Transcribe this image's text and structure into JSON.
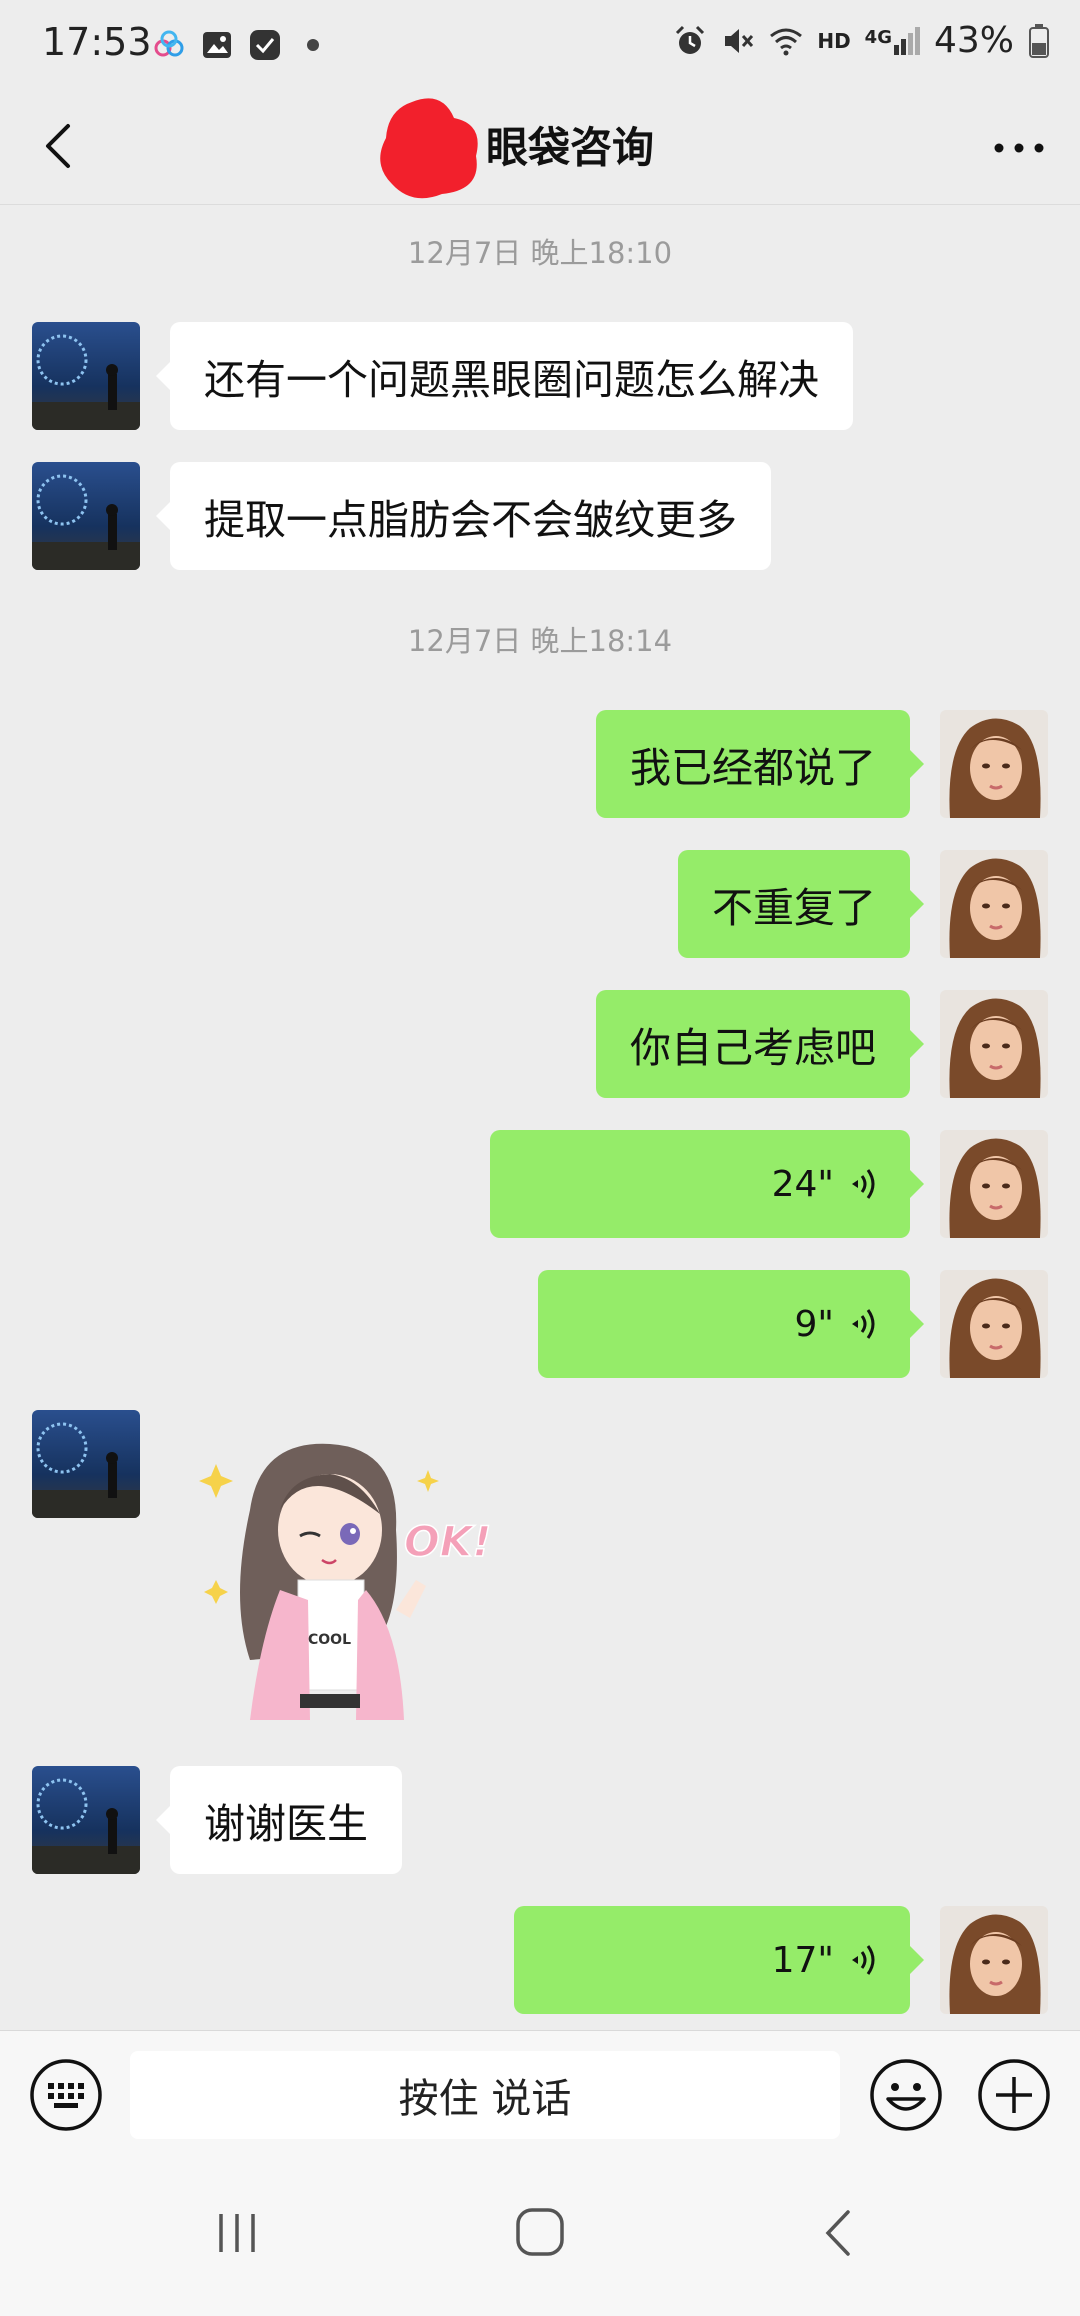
{
  "status_bar": {
    "time": "17:53",
    "network": "HD",
    "signal": "4G",
    "battery": "43%",
    "left_icons": [
      "cloud-icon",
      "gallery-icon",
      "app-check-icon",
      "dot-icon"
    ],
    "right_icons": [
      "alarm-icon",
      "mute-icon",
      "wifi-icon",
      "hd-icon",
      "signal-4g-icon",
      "battery-icon"
    ]
  },
  "header": {
    "title": "眼袋咨询"
  },
  "chat": {
    "timestamps": [
      "12月7日 晚上18:10",
      "12月7日 晚上18:14"
    ],
    "messages": [
      {
        "side": "left",
        "type": "text",
        "text": "还有一个问题黑眼圈问题怎么解决"
      },
      {
        "side": "left",
        "type": "text",
        "text": "提取一点脂肪会不会皱纹更多"
      },
      {
        "side": "right",
        "type": "text",
        "text": "我已经都说了"
      },
      {
        "side": "right",
        "type": "text",
        "text": "不重复了"
      },
      {
        "side": "right",
        "type": "text",
        "text": "你自己考虑吧"
      },
      {
        "side": "right",
        "type": "voice",
        "text": "24\""
      },
      {
        "side": "right",
        "type": "voice",
        "text": "9\""
      },
      {
        "side": "left",
        "type": "sticker",
        "text": "OK!"
      },
      {
        "side": "left",
        "type": "text",
        "text": "谢谢医生"
      },
      {
        "side": "right",
        "type": "voice",
        "text": "17\""
      }
    ],
    "sticker_shirt_text": "COOL"
  },
  "input_bar": {
    "hold_to_talk": "按住 说话"
  },
  "colors": {
    "background": "#EDEDED",
    "my_bubble": "#95EC69",
    "their_bubble": "#FFFFFF",
    "timestamp": "#9B9B9B"
  }
}
